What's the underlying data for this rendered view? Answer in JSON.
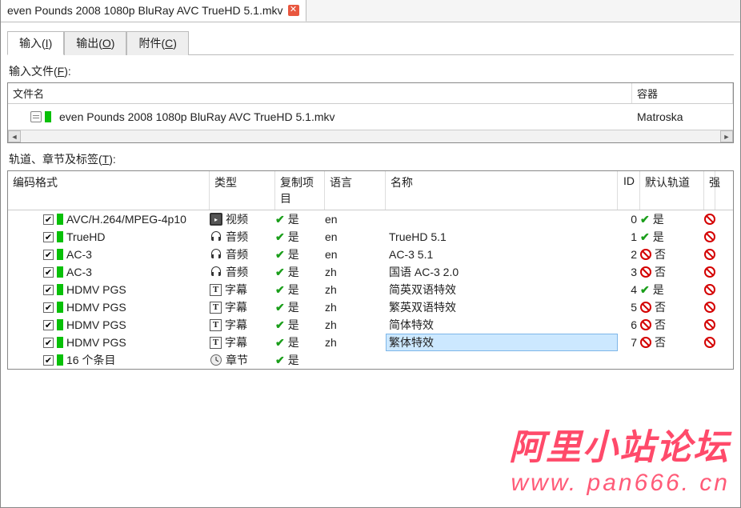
{
  "fileTab": {
    "title": "even Pounds 2008 1080p BluRay AVC TrueHD 5.1.mkv"
  },
  "innerTabs": [
    {
      "label": "输入",
      "mnemonic": "I",
      "active": true
    },
    {
      "label": "输出",
      "mnemonic": "O",
      "active": false
    },
    {
      "label": "附件",
      "mnemonic": "C",
      "active": false
    }
  ],
  "inputFilesLabel": "输入文件(",
  "inputFilesMnemonic": "F",
  "inputFilesLabelEnd": "):",
  "fileListHeaders": {
    "name": "文件名",
    "container": "容器"
  },
  "fileRow": {
    "name": "even Pounds 2008 1080p BluRay AVC TrueHD 5.1.mkv",
    "container": "Matroska"
  },
  "tracksLabel": "轨道、章节及标签(",
  "tracksMnemonic": "T",
  "tracksLabelEnd": "):",
  "trackHeaders": {
    "codec": "编码格式",
    "type": "类型",
    "copy": "复制项目",
    "lang": "语言",
    "name": "名称",
    "id": "ID",
    "default": "默认轨道",
    "forced": "强"
  },
  "typeLabels": {
    "video": "视频",
    "audio": "音频",
    "subtitle": "字幕",
    "chapter": "章节"
  },
  "yes": "是",
  "no": "否",
  "tracks": [
    {
      "checked": true,
      "codec": "AVC/H.264/MPEG-4p10",
      "type": "video",
      "copy": true,
      "lang": "en",
      "name": "",
      "id": 0,
      "default": true,
      "forced": false
    },
    {
      "checked": true,
      "codec": "TrueHD",
      "type": "audio",
      "copy": true,
      "lang": "en",
      "name": "TrueHD 5.1",
      "id": 1,
      "default": true,
      "forced": false
    },
    {
      "checked": true,
      "codec": "AC-3",
      "type": "audio",
      "copy": true,
      "lang": "en",
      "name": "AC-3 5.1",
      "id": 2,
      "default": false,
      "forced": false
    },
    {
      "checked": true,
      "codec": "AC-3",
      "type": "audio",
      "copy": true,
      "lang": "zh",
      "name": "国语 AC-3 2.0",
      "id": 3,
      "default": false,
      "forced": false
    },
    {
      "checked": true,
      "codec": "HDMV PGS",
      "type": "subtitle",
      "copy": true,
      "lang": "zh",
      "name": "简英双语特效",
      "id": 4,
      "default": true,
      "forced": false
    },
    {
      "checked": true,
      "codec": "HDMV PGS",
      "type": "subtitle",
      "copy": true,
      "lang": "zh",
      "name": "繁英双语特效",
      "id": 5,
      "default": false,
      "forced": false
    },
    {
      "checked": true,
      "codec": "HDMV PGS",
      "type": "subtitle",
      "copy": true,
      "lang": "zh",
      "name": "简体特效",
      "id": 6,
      "default": false,
      "forced": false
    },
    {
      "checked": true,
      "codec": "HDMV PGS",
      "type": "subtitle",
      "copy": true,
      "lang": "zh",
      "name": "繁体特效",
      "id": 7,
      "default": false,
      "forced": false,
      "selected": true
    },
    {
      "checked": true,
      "codec": "16 个条目",
      "type": "chapter",
      "copy": true,
      "lang": "",
      "name": "",
      "id": "",
      "default": null,
      "forced": null
    }
  ],
  "watermark": {
    "line1": "阿里小站论坛",
    "line2": "www. pan666. cn"
  }
}
